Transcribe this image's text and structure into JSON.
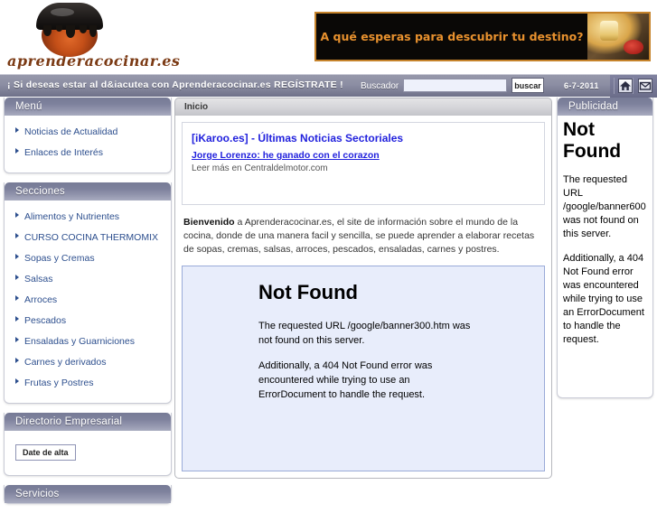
{
  "header": {
    "logo_text": "aprenderacocinar.es",
    "banner": {
      "text": "A qué esperas para descubrir tu destino?"
    }
  },
  "navstrip": {
    "promo_text": "¡ Si deseas estar al d&iacutea con Aprenderacocinar.es REGÍSTRATE !",
    "search_label": "Buscador",
    "search_value": "",
    "search_placeholder": "",
    "search_button": "buscar",
    "date": "6-7-2011",
    "icons": [
      "home-icon",
      "mail-icon"
    ]
  },
  "sidebar_left": {
    "blocks": [
      {
        "title": "Menú",
        "items": [
          {
            "label": "Noticias de Actualidad"
          },
          {
            "label": "Enlaces de Interés"
          }
        ]
      },
      {
        "title": "Secciones",
        "items": [
          {
            "label": "Alimentos y Nutrientes"
          },
          {
            "label": "CURSO COCINA THERMOMIX"
          },
          {
            "label": "Sopas y Cremas"
          },
          {
            "label": "Salsas"
          },
          {
            "label": "Arroces"
          },
          {
            "label": "Pescados"
          },
          {
            "label": "Ensaladas y Guarniciones"
          },
          {
            "label": "Carnes y derivados"
          },
          {
            "label": "Frutas y Postres"
          }
        ]
      },
      {
        "title": "Directorio Empresarial",
        "button_label": "Date de alta"
      },
      {
        "title": "Servicios"
      }
    ]
  },
  "main": {
    "tab_label": "Inicio",
    "news": {
      "title": "[iKaroo.es] - Últimas Noticias Sectoriales",
      "link": "Jorge Lorenzo: he ganado con el corazon",
      "source": "Leer más en Centraldelmotor.com"
    },
    "welcome": {
      "lead": "Bienvenido",
      "text": " a Aprenderacocinar.es, el site de información sobre el mundo de la cocina, donde de una manera facil y sencilla, se puede aprender a elaborar recetas de sopas, cremas, salsas, arroces, pescados, ensaladas, carnes y postres."
    },
    "not_found": {
      "title": "Not Found",
      "para1": "The requested URL /google/banner300.htm was not found on this server.",
      "para2": "Additionally, a 404 Not Found error was encountered while trying to use an ErrorDocument to handle the request."
    }
  },
  "sidebar_right": {
    "title": "Publicidad",
    "not_found": {
      "title": "Not Found",
      "para1": "The requested URL /google/banner600 was not found on this server.",
      "para2": "Additionally, a 404 Not Found error was encountered while trying to use an ErrorDocument to handle the request."
    }
  },
  "colors": {
    "panel_header_dark": "#767a96",
    "panel_header_light": "#a8abbf",
    "navstrip": "#8c8ea3",
    "link_blue": "#2d4f8e",
    "news_blue": "#2222dd",
    "banner_orange": "#e8912e",
    "notfound_bg": "#e8edfb",
    "logo_brown": "#7b3a14"
  }
}
